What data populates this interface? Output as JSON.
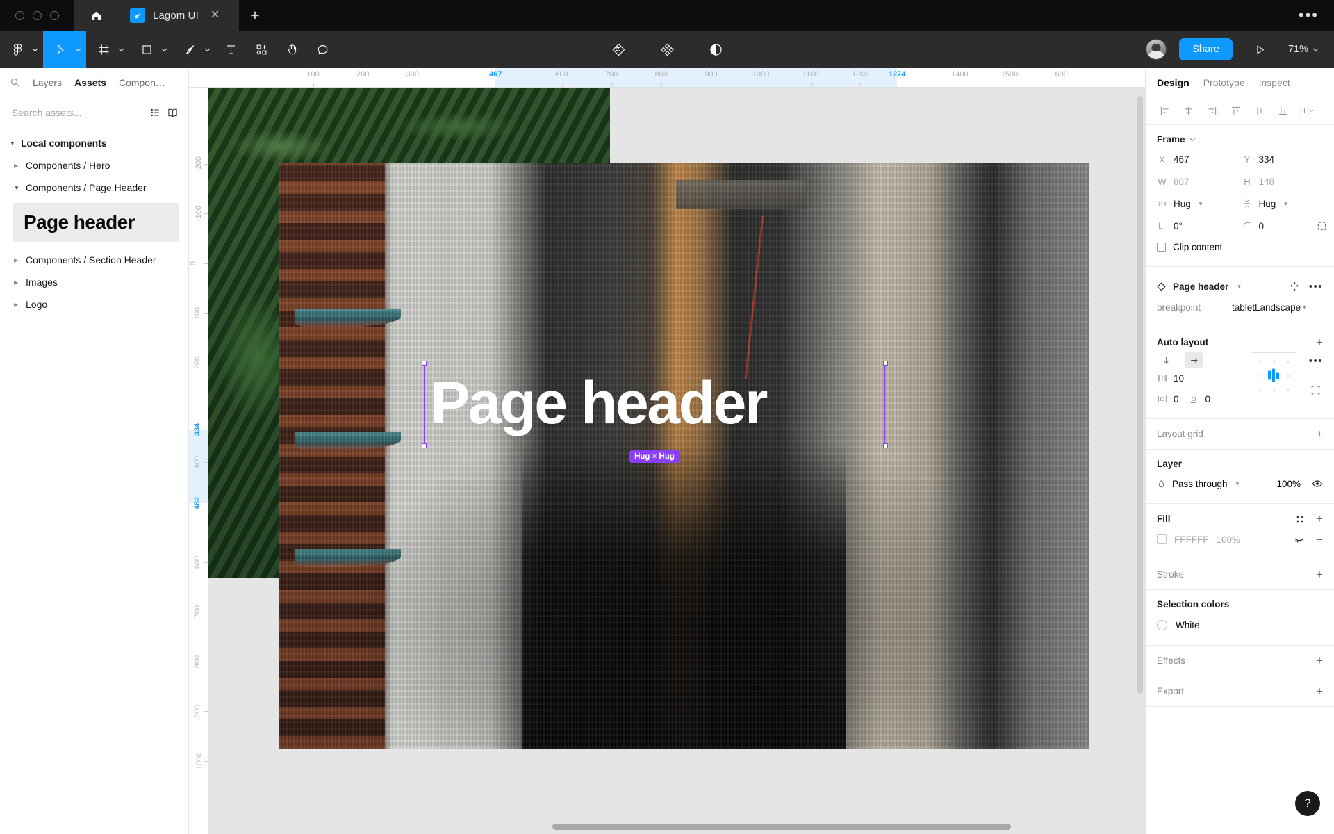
{
  "titlebar": {
    "home_icon": "home-icon",
    "tab": {
      "title": "Lagom UI",
      "favicon": "figma-file-icon",
      "close": "✕"
    },
    "new_tab": "+",
    "overflow": "•••"
  },
  "toolbar": {
    "tools": [
      {
        "name": "figma-menu",
        "icon": "figma-logo-icon",
        "caret": true,
        "active": false
      },
      {
        "name": "move",
        "icon": "cursor-icon",
        "caret": true,
        "active": true
      },
      {
        "name": "frame",
        "icon": "frame-icon",
        "caret": true,
        "active": false
      },
      {
        "name": "shape",
        "icon": "rectangle-icon",
        "caret": true,
        "active": false
      },
      {
        "name": "pen",
        "icon": "pen-icon",
        "caret": true,
        "active": false
      },
      {
        "name": "text",
        "icon": "text-icon",
        "caret": false,
        "active": false
      },
      {
        "name": "components",
        "icon": "plugin-icon",
        "caret": false,
        "active": false
      },
      {
        "name": "hand",
        "icon": "hand-icon",
        "caret": false,
        "active": false
      },
      {
        "name": "comment",
        "icon": "comment-icon",
        "caret": false,
        "active": false
      }
    ],
    "center_icons": [
      {
        "name": "reset-instance",
        "icon": "reset-instance-icon"
      },
      {
        "name": "component-set",
        "icon": "component-diamonds-icon"
      },
      {
        "name": "contrast",
        "icon": "contrast-icon"
      }
    ],
    "avatar": "user-avatar",
    "share_label": "Share",
    "present_icon": "play-icon",
    "zoom_level": "71%",
    "accent_color": "#0D99FF"
  },
  "left_panel": {
    "tabs": [
      {
        "label": "Layers",
        "active": false
      },
      {
        "label": "Assets",
        "active": true
      },
      {
        "label": "Compon…",
        "active": false
      }
    ],
    "search_placeholder": "Search assets...",
    "list_view_icon": "list-view-icon",
    "library_icon": "book-icon",
    "section": {
      "label": "Local components",
      "expanded": true
    },
    "items": [
      {
        "label": "Components / Hero",
        "expanded": false
      },
      {
        "label": "Components / Page Header",
        "expanded": true
      },
      {
        "label": "Components / Section Header",
        "expanded": false
      },
      {
        "label": "Images",
        "expanded": false
      },
      {
        "label": "Logo",
        "expanded": false
      }
    ],
    "asset_thumb_label": "Page header"
  },
  "canvas": {
    "ruler_h": {
      "ticks": [
        100,
        200,
        300,
        467,
        600,
        700,
        800,
        900,
        1000,
        1100,
        1200,
        1274,
        1400,
        1500,
        1600
      ],
      "selected": [
        467,
        1274
      ],
      "band": {
        "from": 467,
        "to": 1274
      }
    },
    "ruler_v": {
      "ticks": [
        -200,
        -100,
        0,
        100,
        200,
        334,
        400,
        482,
        600,
        700,
        800,
        900,
        1000
      ],
      "selected": [
        334,
        482
      ],
      "band": {
        "from": 334,
        "to": 482
      }
    },
    "headline_text": "Page header",
    "selection_badge": "Hug × Hug",
    "selection_color": "#8A3FFC"
  },
  "right_panel": {
    "tabs": [
      {
        "label": "Design",
        "active": true
      },
      {
        "label": "Prototype",
        "active": false
      },
      {
        "label": "Inspect",
        "active": false
      }
    ],
    "align_buttons": [
      "align-left-icon",
      "align-horizontal-center-icon",
      "align-right-icon",
      "align-top-icon",
      "align-vertical-center-icon",
      "align-bottom-icon",
      "distribute-icon"
    ],
    "frame": {
      "title": "Frame",
      "x_label": "X",
      "x_value": "467",
      "y_label": "Y",
      "y_value": "334",
      "w_label": "W",
      "w_value": "807",
      "h_label": "H",
      "h_value": "148",
      "resize_w_label": "Hug",
      "resize_h_label": "Hug",
      "rotation_value": "0°",
      "corner_radius_value": "0",
      "independent_corners_icon": "independent-corners-icon",
      "clip_content_label": "Clip content",
      "clip_content_checked": false
    },
    "component": {
      "name": "Page header",
      "swap_icon": "swap-instance-icon",
      "more_icon": "more-options-icon",
      "property_key": "breakpoint",
      "property_value": "tabletLandscape"
    },
    "auto_layout": {
      "title": "Auto layout",
      "add_icon": "plus-icon",
      "direction_vertical_icon": "arrow-down-icon",
      "direction_horizontal_icon": "arrow-right-icon",
      "direction_selected": "horizontal",
      "spacing_value": "10",
      "horizontal_padding_value": "0",
      "vertical_padding_value": "0",
      "more_icon": "more-options-icon",
      "clip_icon": "clip-content-icon"
    },
    "layout_grid": {
      "title": "Layout grid",
      "add_icon": "plus-icon"
    },
    "layer": {
      "title": "Layer",
      "blend_mode": "Pass through",
      "opacity": "100%",
      "visibility_icon": "eye-icon"
    },
    "fill": {
      "title": "Fill",
      "style_icon": "style-picker-icon",
      "add_icon": "plus-icon",
      "color_hex": "FFFFFF",
      "opacity": "100%",
      "visibility_icon": "eye-closed-icon",
      "remove_icon": "minus-icon"
    },
    "stroke": {
      "title": "Stroke",
      "add_icon": "plus-icon"
    },
    "selection_colors": {
      "title": "Selection colors",
      "items": [
        {
          "label": "White"
        }
      ]
    },
    "effects": {
      "title": "Effects",
      "add_icon": "plus-icon"
    },
    "export": {
      "title": "Export",
      "add_icon": "plus-icon"
    },
    "help_label": "?"
  }
}
